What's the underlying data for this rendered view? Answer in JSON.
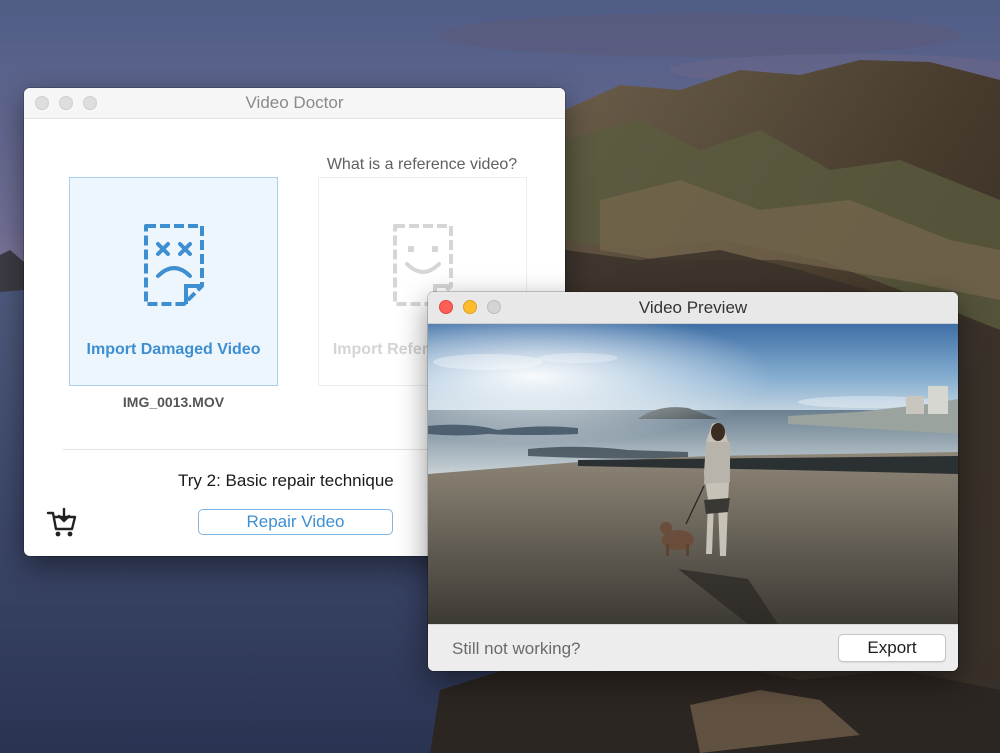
{
  "doctor_window": {
    "title": "Video Doctor",
    "reference_question": "What is a reference video?",
    "damaged_card": {
      "label": "Import Damaged Video",
      "file_name": "IMG_0013.MOV",
      "icon": "sad-document-icon"
    },
    "reference_card": {
      "label": "Import Reference Video",
      "icon": "happy-document-icon"
    },
    "try_text": "Try 2: Basic repair technique",
    "repair_button": "Repair Video",
    "cart_icon": "shopping-cart-icon"
  },
  "preview_window": {
    "title": "Video Preview",
    "footer_text": "Still not working?",
    "export_button": "Export"
  },
  "colors": {
    "accent_blue": "#3e8fd1",
    "card_border": "#a9d1ef",
    "card_bg": "#eef6fd",
    "traffic_red": "#fd5f57",
    "traffic_yellow": "#fdbc2e"
  }
}
